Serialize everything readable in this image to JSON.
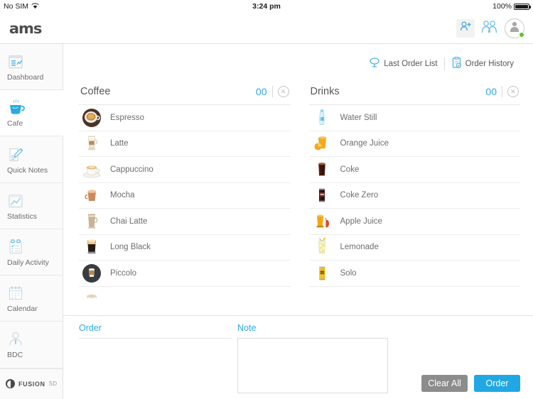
{
  "status_bar": {
    "carrier": "No SIM",
    "wifi_icon": "wifi-icon",
    "time": "3:24 pm",
    "battery_percent": "100%"
  },
  "appbar": {
    "logo_text": "ams",
    "actions": [
      {
        "name": "add-user-icon",
        "label": "Add User"
      },
      {
        "name": "users-group-icon",
        "label": "Users"
      },
      {
        "name": "account-avatar",
        "label": "Account"
      }
    ]
  },
  "sidebar": {
    "items": [
      {
        "label": "Dashboard",
        "icon": "dashboard-icon",
        "active": false
      },
      {
        "label": "Cafe",
        "icon": "coffee-cup-icon",
        "active": true
      },
      {
        "label": "Quick Notes",
        "icon": "note-pencil-icon",
        "active": false
      },
      {
        "label": "Statistics",
        "icon": "line-chart-icon",
        "active": false
      },
      {
        "label": "Daily Activity",
        "icon": "checklist-icon",
        "active": false
      },
      {
        "label": "Calendar",
        "icon": "calendar-icon",
        "active": false
      },
      {
        "label": "BDC",
        "icon": "person-tie-icon",
        "active": false
      }
    ],
    "footer": {
      "brand": "FUSION",
      "suffix": "SD",
      "icon": "fusion-logo-icon"
    }
  },
  "toolbar": {
    "last_order_list": "Last Order List",
    "order_history": "Order History"
  },
  "categories": [
    {
      "title": "Coffee",
      "count": "00",
      "clear_icon": "close-circle-icon",
      "items": [
        {
          "name": "Espresso",
          "icon": "espresso-cup-icon"
        },
        {
          "name": "Latte",
          "icon": "latte-glass-icon"
        },
        {
          "name": "Cappuccino",
          "icon": "cappuccino-cup-icon"
        },
        {
          "name": "Mocha",
          "icon": "mocha-cup-icon"
        },
        {
          "name": "Chai Latte",
          "icon": "chai-latte-glass-icon"
        },
        {
          "name": "Long Black",
          "icon": "long-black-glass-icon"
        },
        {
          "name": "Piccolo",
          "icon": "piccolo-cup-icon"
        },
        {
          "name": "",
          "icon": "flat-white-cup-icon"
        }
      ]
    },
    {
      "title": "Drinks",
      "count": "00",
      "clear_icon": "close-circle-icon",
      "items": [
        {
          "name": "Water Still",
          "icon": "water-bottle-icon"
        },
        {
          "name": "Orange Juice",
          "icon": "orange-juice-icon"
        },
        {
          "name": "Coke",
          "icon": "coke-glass-icon"
        },
        {
          "name": "Coke Zero",
          "icon": "coke-zero-can-icon"
        },
        {
          "name": "Apple Juice",
          "icon": "apple-juice-icon"
        },
        {
          "name": "Lemonade",
          "icon": "lemonade-glass-icon"
        },
        {
          "name": "Solo",
          "icon": "solo-can-icon"
        }
      ]
    }
  ],
  "bottom": {
    "order_label": "Order",
    "note_label": "Note",
    "note_value": "",
    "note_placeholder": "",
    "clear_all_button": "Clear All",
    "order_button": "Order"
  },
  "colors": {
    "accent": "#22a7e5",
    "accent_light": "#2fa8e8",
    "clear_button": "#8c8c8c",
    "text_muted": "#6e6e6e",
    "online_dot": "#62c12c"
  }
}
